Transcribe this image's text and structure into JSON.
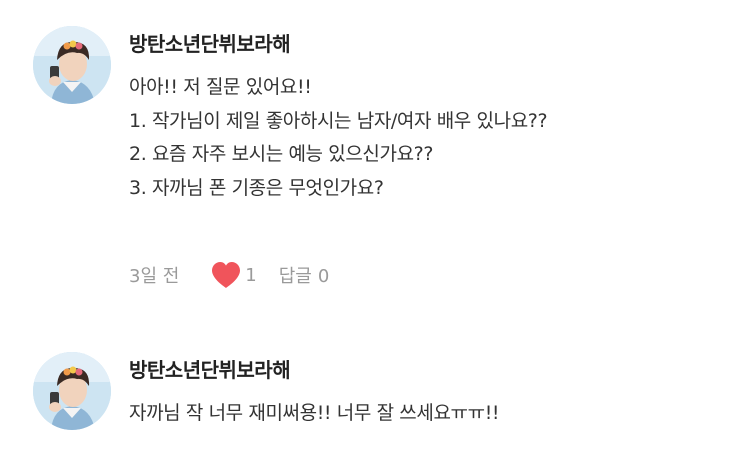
{
  "comments": [
    {
      "author": "방탄소년단뷔보라해",
      "lines": [
        "아아!! 저 질문 있어요!!",
        "1. 작가님이 제일 좋아하시는 남자/여자 배우 있나요??",
        "2. 요즘 자주 보시는 예능 있으신가요??",
        "3. 자까님 폰 기종은 무엇인가요?"
      ],
      "time": "3일 전",
      "likes": "1",
      "reply_label": "답글",
      "reply_count": "0"
    },
    {
      "author": "방탄소년단뷔보라해",
      "lines": [
        "자까님 작 너무 재미써용!! 너무 잘 쓰세요ㅠㅠ!!"
      ]
    }
  ],
  "colors": {
    "heart": "#f0545b",
    "meta_text": "#9a9a9a",
    "author_text": "#222222",
    "body_text": "#333333"
  },
  "icons": {
    "like": "heart-icon",
    "avatar": "profile-photo"
  }
}
